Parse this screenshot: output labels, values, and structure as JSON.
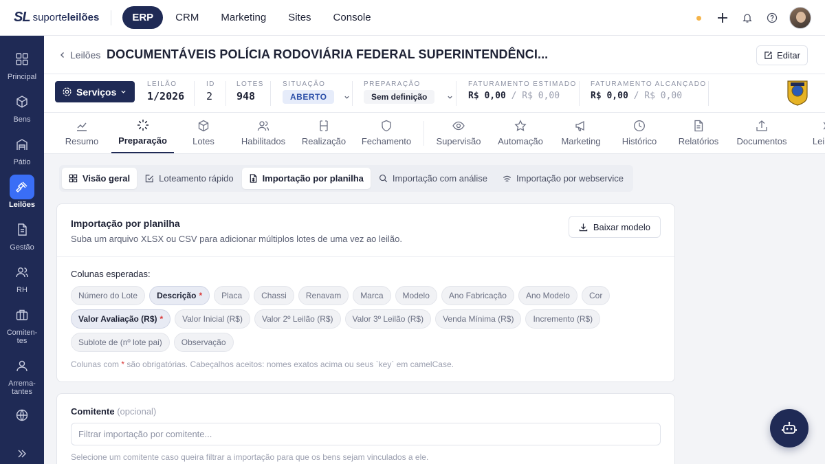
{
  "brand": {
    "mark": "SL",
    "name_light": "suporte",
    "name_bold": "leilões"
  },
  "topnav": [
    {
      "label": "ERP",
      "active": true
    },
    {
      "label": "CRM"
    },
    {
      "label": "Marketing"
    },
    {
      "label": "Sites"
    },
    {
      "label": "Console"
    }
  ],
  "colors": {
    "brand": "#1f2a55",
    "accent": "#3a6ef6",
    "required": "#d93636",
    "status_dot": "#f5b44a"
  },
  "sidebar": {
    "items": [
      {
        "label": "Principal",
        "icon": "grid-icon"
      },
      {
        "label": "Bens",
        "icon": "box-icon"
      },
      {
        "label": "Pátio",
        "icon": "warehouse-icon"
      },
      {
        "label": "Leilões",
        "icon": "gavel-icon",
        "active": true
      },
      {
        "label": "Gestão",
        "icon": "document-icon"
      },
      {
        "label": "RH",
        "icon": "users-icon"
      },
      {
        "label": "Comiten-tes",
        "icon": "briefcase-icon"
      },
      {
        "label": "Arrema-tantes",
        "icon": "user-icon"
      },
      {
        "label": "",
        "icon": "globe-icon"
      }
    ],
    "expand_icon": "chevrons-right-icon"
  },
  "header": {
    "back_label": "Leilões",
    "title": "DOCUMENTÁVEIS POLÍCIA RODOVIÁRIA FEDERAL SUPERINTENDÊNCI...",
    "edit_label": "Editar"
  },
  "info": {
    "services_label": "Serviços",
    "leilao_label": "LEILÃO",
    "leilao_value": "1/2026",
    "id_label": "ID",
    "id_value": "2",
    "lotes_label": "LOTES",
    "lotes_value": "948",
    "situacao_label": "SITUAÇÃO",
    "situacao_value": "ABERTO",
    "preparacao_label": "PREPARAÇÃO",
    "preparacao_value": "Sem definição",
    "fat_est_label": "FATURAMENTO ESTIMADO",
    "fat_est_value": "R$ 0,00",
    "fat_est_sub": "/ R$ 0,00",
    "fat_alc_label": "FATURAMENTO ALCANÇADO",
    "fat_alc_value": "R$ 0,00",
    "fat_alc_sub": "/ R$ 0,00",
    "logo_icon": "prf-badge-icon"
  },
  "modtabs": [
    {
      "label": "Resumo",
      "icon": "chart-line-icon"
    },
    {
      "label": "Preparação",
      "icon": "spinner-icon",
      "active": true
    },
    {
      "label": "Lotes",
      "icon": "box-icon"
    },
    {
      "label": "Habilitados",
      "icon": "users-icon"
    },
    {
      "label": "Realização",
      "icon": "gavel-icon"
    },
    {
      "label": "Fechamento",
      "icon": "shield-icon"
    },
    {
      "label": "Supervisão",
      "icon": "eye-icon"
    },
    {
      "label": "Automação",
      "icon": "star-icon"
    },
    {
      "label": "Marketing",
      "icon": "megaphone-icon"
    },
    {
      "label": "Histórico",
      "icon": "clock-icon"
    },
    {
      "label": "Relatórios",
      "icon": "report-icon"
    },
    {
      "label": "Documentos",
      "icon": "upload-icon"
    },
    {
      "label": "Leil",
      "icon": "partial-icon"
    }
  ],
  "subtabs": [
    {
      "label": "Visão geral",
      "icon": "layout-icon"
    },
    {
      "label": "Loteamento rápido",
      "icon": "checkbox-edit-icon"
    },
    {
      "label": "Importação por planilha",
      "icon": "file-sheet-icon",
      "selected": true
    },
    {
      "label": "Importação com análise",
      "icon": "search-analysis-icon"
    },
    {
      "label": "Importação por webservice",
      "icon": "webservice-icon"
    }
  ],
  "import_card": {
    "title": "Importação por planilha",
    "subtitle": "Suba um arquivo XLSX ou CSV para adicionar múltiplos lotes de uma vez ao leilão.",
    "download_label": "Baixar modelo",
    "columns_label": "Colunas esperadas:",
    "columns": [
      {
        "label": "Número do Lote"
      },
      {
        "label": "Descrição",
        "required": true
      },
      {
        "label": "Placa"
      },
      {
        "label": "Chassi"
      },
      {
        "label": "Renavam"
      },
      {
        "label": "Marca"
      },
      {
        "label": "Modelo"
      },
      {
        "label": "Ano Fabricação"
      },
      {
        "label": "Ano Modelo"
      },
      {
        "label": "Cor"
      },
      {
        "label": "Valor Avaliação (R$)",
        "required": true
      },
      {
        "label": "Valor Inicial (R$)"
      },
      {
        "label": "Valor 2º Leilão (R$)"
      },
      {
        "label": "Valor 3º Leilão (R$)"
      },
      {
        "label": "Venda Mínima (R$)"
      },
      {
        "label": "Incremento (R$)"
      },
      {
        "label": "Sublote de (nº lote pai)"
      },
      {
        "label": "Observação"
      }
    ],
    "note_prefix": "Colunas com",
    "note_star": "*",
    "note_suffix": "são obrigatórias. Cabeçalhos aceitos: nomes exatos acima ou seus `key` em camelCase."
  },
  "comitente_card": {
    "label": "Comitente",
    "optional": "(opcional)",
    "placeholder": "Filtrar importação por comitente...",
    "hint": "Selecione um comitente caso queira filtrar a importação para que os bens sejam vinculados a ele."
  },
  "assistant_icon": "robot-icon"
}
